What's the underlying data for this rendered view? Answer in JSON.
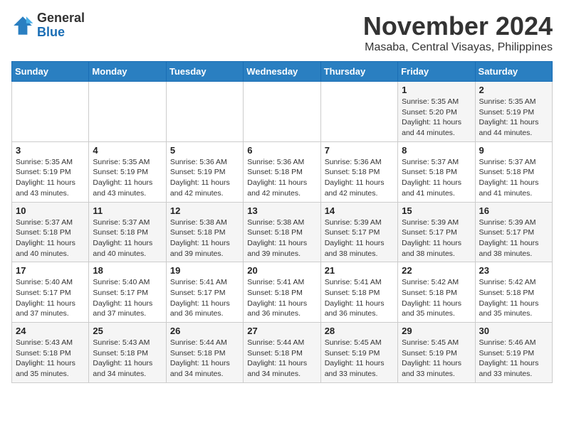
{
  "header": {
    "logo": {
      "general": "General",
      "blue": "Blue"
    },
    "title": "November 2024",
    "subtitle": "Masaba, Central Visayas, Philippines"
  },
  "calendar": {
    "headers": [
      "Sunday",
      "Monday",
      "Tuesday",
      "Wednesday",
      "Thursday",
      "Friday",
      "Saturday"
    ],
    "weeks": [
      [
        {
          "day": "",
          "info": ""
        },
        {
          "day": "",
          "info": ""
        },
        {
          "day": "",
          "info": ""
        },
        {
          "day": "",
          "info": ""
        },
        {
          "day": "",
          "info": ""
        },
        {
          "day": "1",
          "info": "Sunrise: 5:35 AM\nSunset: 5:20 PM\nDaylight: 11 hours\nand 44 minutes."
        },
        {
          "day": "2",
          "info": "Sunrise: 5:35 AM\nSunset: 5:19 PM\nDaylight: 11 hours\nand 44 minutes."
        }
      ],
      [
        {
          "day": "3",
          "info": "Sunrise: 5:35 AM\nSunset: 5:19 PM\nDaylight: 11 hours\nand 43 minutes."
        },
        {
          "day": "4",
          "info": "Sunrise: 5:35 AM\nSunset: 5:19 PM\nDaylight: 11 hours\nand 43 minutes."
        },
        {
          "day": "5",
          "info": "Sunrise: 5:36 AM\nSunset: 5:19 PM\nDaylight: 11 hours\nand 42 minutes."
        },
        {
          "day": "6",
          "info": "Sunrise: 5:36 AM\nSunset: 5:18 PM\nDaylight: 11 hours\nand 42 minutes."
        },
        {
          "day": "7",
          "info": "Sunrise: 5:36 AM\nSunset: 5:18 PM\nDaylight: 11 hours\nand 42 minutes."
        },
        {
          "day": "8",
          "info": "Sunrise: 5:37 AM\nSunset: 5:18 PM\nDaylight: 11 hours\nand 41 minutes."
        },
        {
          "day": "9",
          "info": "Sunrise: 5:37 AM\nSunset: 5:18 PM\nDaylight: 11 hours\nand 41 minutes."
        }
      ],
      [
        {
          "day": "10",
          "info": "Sunrise: 5:37 AM\nSunset: 5:18 PM\nDaylight: 11 hours\nand 40 minutes."
        },
        {
          "day": "11",
          "info": "Sunrise: 5:37 AM\nSunset: 5:18 PM\nDaylight: 11 hours\nand 40 minutes."
        },
        {
          "day": "12",
          "info": "Sunrise: 5:38 AM\nSunset: 5:18 PM\nDaylight: 11 hours\nand 39 minutes."
        },
        {
          "day": "13",
          "info": "Sunrise: 5:38 AM\nSunset: 5:18 PM\nDaylight: 11 hours\nand 39 minutes."
        },
        {
          "day": "14",
          "info": "Sunrise: 5:39 AM\nSunset: 5:17 PM\nDaylight: 11 hours\nand 38 minutes."
        },
        {
          "day": "15",
          "info": "Sunrise: 5:39 AM\nSunset: 5:17 PM\nDaylight: 11 hours\nand 38 minutes."
        },
        {
          "day": "16",
          "info": "Sunrise: 5:39 AM\nSunset: 5:17 PM\nDaylight: 11 hours\nand 38 minutes."
        }
      ],
      [
        {
          "day": "17",
          "info": "Sunrise: 5:40 AM\nSunset: 5:17 PM\nDaylight: 11 hours\nand 37 minutes."
        },
        {
          "day": "18",
          "info": "Sunrise: 5:40 AM\nSunset: 5:17 PM\nDaylight: 11 hours\nand 37 minutes."
        },
        {
          "day": "19",
          "info": "Sunrise: 5:41 AM\nSunset: 5:17 PM\nDaylight: 11 hours\nand 36 minutes."
        },
        {
          "day": "20",
          "info": "Sunrise: 5:41 AM\nSunset: 5:18 PM\nDaylight: 11 hours\nand 36 minutes."
        },
        {
          "day": "21",
          "info": "Sunrise: 5:41 AM\nSunset: 5:18 PM\nDaylight: 11 hours\nand 36 minutes."
        },
        {
          "day": "22",
          "info": "Sunrise: 5:42 AM\nSunset: 5:18 PM\nDaylight: 11 hours\nand 35 minutes."
        },
        {
          "day": "23",
          "info": "Sunrise: 5:42 AM\nSunset: 5:18 PM\nDaylight: 11 hours\nand 35 minutes."
        }
      ],
      [
        {
          "day": "24",
          "info": "Sunrise: 5:43 AM\nSunset: 5:18 PM\nDaylight: 11 hours\nand 35 minutes."
        },
        {
          "day": "25",
          "info": "Sunrise: 5:43 AM\nSunset: 5:18 PM\nDaylight: 11 hours\nand 34 minutes."
        },
        {
          "day": "26",
          "info": "Sunrise: 5:44 AM\nSunset: 5:18 PM\nDaylight: 11 hours\nand 34 minutes."
        },
        {
          "day": "27",
          "info": "Sunrise: 5:44 AM\nSunset: 5:18 PM\nDaylight: 11 hours\nand 34 minutes."
        },
        {
          "day": "28",
          "info": "Sunrise: 5:45 AM\nSunset: 5:19 PM\nDaylight: 11 hours\nand 33 minutes."
        },
        {
          "day": "29",
          "info": "Sunrise: 5:45 AM\nSunset: 5:19 PM\nDaylight: 11 hours\nand 33 minutes."
        },
        {
          "day": "30",
          "info": "Sunrise: 5:46 AM\nSunset: 5:19 PM\nDaylight: 11 hours\nand 33 minutes."
        }
      ]
    ]
  }
}
